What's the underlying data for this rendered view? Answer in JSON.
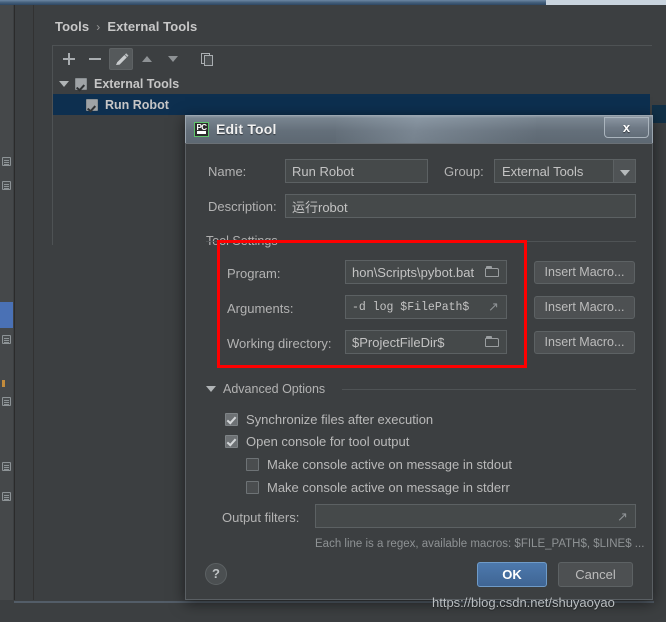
{
  "window": {
    "breadcrumb": {
      "root": "Tools",
      "separator": "›",
      "current": "External Tools"
    }
  },
  "toolbar": {
    "items": [
      {
        "name": "add-button",
        "icon": "plus-icon",
        "label": "+"
      },
      {
        "name": "remove-button",
        "icon": "minus-icon",
        "label": "−"
      },
      {
        "name": "edit-button",
        "icon": "pencil-icon",
        "label": "Edit"
      },
      {
        "name": "move-up-button",
        "icon": "arrow-up-icon",
        "label": "Up"
      },
      {
        "name": "move-down-button",
        "icon": "arrow-down-icon",
        "label": "Down"
      },
      {
        "name": "copy-button",
        "icon": "copy-icon",
        "label": "Copy"
      }
    ]
  },
  "tree": {
    "group": {
      "label": "External Tools",
      "checked": true,
      "expanded": true
    },
    "child": {
      "label": "Run Robot",
      "checked": true,
      "selected": true
    }
  },
  "dialog": {
    "icon": "pycharm-icon",
    "icon_text": "PC",
    "title": "Edit Tool",
    "close_label": "x",
    "name": {
      "label": "Name:",
      "value": "Run Robot"
    },
    "group": {
      "label": "Group:",
      "value": "External Tools",
      "arrow_icon": "chevron-down-icon"
    },
    "description": {
      "label": "Description:",
      "value": "运行robot"
    },
    "tool_settings": {
      "group_title": "Tool Settings",
      "rows": [
        {
          "label": "Program:",
          "value": "hon\\Scripts\\pybot.bat",
          "field_icon": "folder-icon",
          "mono": false,
          "button": "Insert Macro..."
        },
        {
          "label": "Arguments:",
          "value": "-d log $FilePath$",
          "field_icon": "expand-icon",
          "mono": true,
          "button": "Insert Macro..."
        },
        {
          "label": "Working directory:",
          "value": "$ProjectFileDir$",
          "field_icon": "folder-icon",
          "mono": false,
          "button": "Insert Macro..."
        }
      ]
    },
    "advanced_options": {
      "label": "Advanced Options",
      "expanded": true,
      "options": [
        {
          "label": "Synchronize files after execution",
          "checked": true,
          "indent": 0
        },
        {
          "label": "Open console for tool output",
          "checked": true,
          "indent": 0
        },
        {
          "label": "Make console active on message in stdout",
          "checked": false,
          "indent": 1
        },
        {
          "label": "Make console active on message in stderr",
          "checked": false,
          "indent": 1
        }
      ]
    },
    "output_filters": {
      "label": "Output filters:",
      "value": "",
      "field_icon": "expand-icon",
      "hint": "Each line is a regex, available macros: $FILE_PATH$, $LINE$ ..."
    },
    "footer": {
      "help_label": "?",
      "ok_label": "OK",
      "cancel_label": "Cancel"
    }
  },
  "annotation": {
    "highlight_color": "#fe0000"
  },
  "watermark": {
    "text": "https://blog.csdn.net/shuyaoyao"
  }
}
